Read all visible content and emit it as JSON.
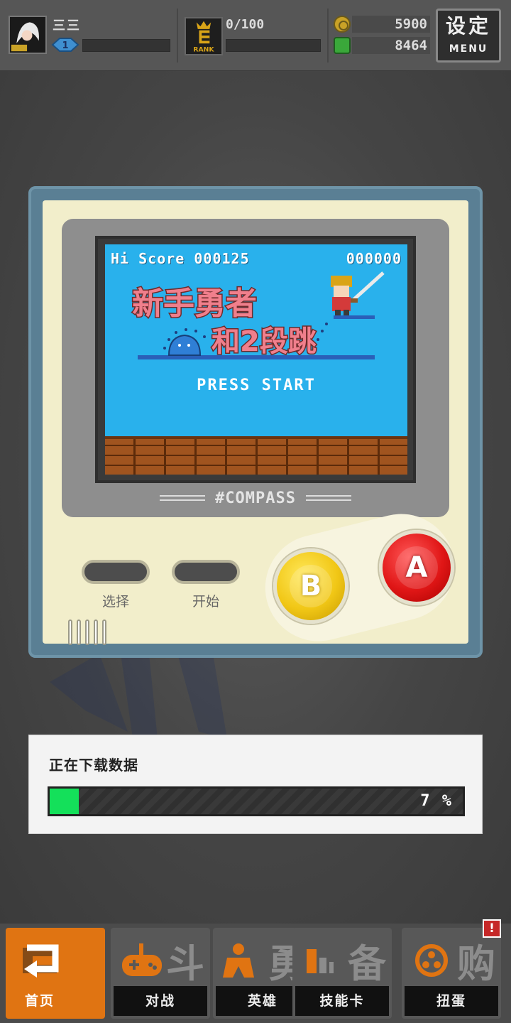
{
  "topbar": {
    "player_name": "三三",
    "player_level": "1",
    "rank_label": "RANK",
    "rank_progress": "0/100",
    "coins": "5900",
    "gems": "8464",
    "menu_big": "设定",
    "menu_small": "MENU"
  },
  "game_screen": {
    "hi_score": "Hi Score 000125",
    "score": "000000",
    "title_line1": "新手勇者",
    "title_line2": "和2段跳",
    "press_start": "PRESS START",
    "brand": "#COMPASS"
  },
  "controls": {
    "select_label": "选择",
    "start_label": "开始",
    "b_label": "B",
    "a_label": "A"
  },
  "download": {
    "label": "正在下载数据",
    "progress_percent": 7,
    "progress_text": "7 %",
    "fill_color": "#14e05a"
  },
  "nav": {
    "items": [
      {
        "label": "首页",
        "char": "",
        "icon": "home-return-icon"
      },
      {
        "label": "对战",
        "char": "斗",
        "icon": "gamepad-icon"
      },
      {
        "label": "英雄",
        "char": "勇",
        "icon": "hero-icon"
      },
      {
        "label": "技能卡",
        "char": "备",
        "icon": "cards-icon"
      },
      {
        "label": "扭蛋",
        "char": "购",
        "icon": "gacha-icon"
      }
    ],
    "notice": "!"
  },
  "colors": {
    "accent_active_tab": "#e07412",
    "screen_blue": "#29b1ec",
    "button_a": "#e01616",
    "button_b": "#f1c716"
  }
}
